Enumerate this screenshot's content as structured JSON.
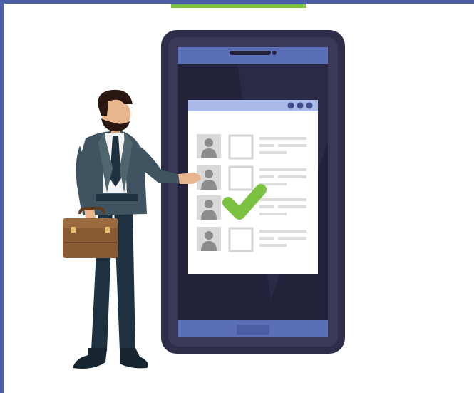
{
  "colors": {
    "frame": "#4a5fa8",
    "accent": "#7cc242",
    "phone_body": "#2e2d4a",
    "phone_screen": "#23223a",
    "phone_bar": "#5a6fb8",
    "app_header": "#a9b9ea",
    "app_bg": "#ffffff",
    "avatar_bg": "#d9d9d9",
    "avatar_fg": "#8c8c8c",
    "check": "#7cc242",
    "suit": "#3f5460",
    "pants": "#1e3140",
    "briefcase": "#8a5a32"
  },
  "illustration": {
    "subject": "businessman-selecting-candidate",
    "candidate_rows": 4,
    "selected_row": 3
  }
}
